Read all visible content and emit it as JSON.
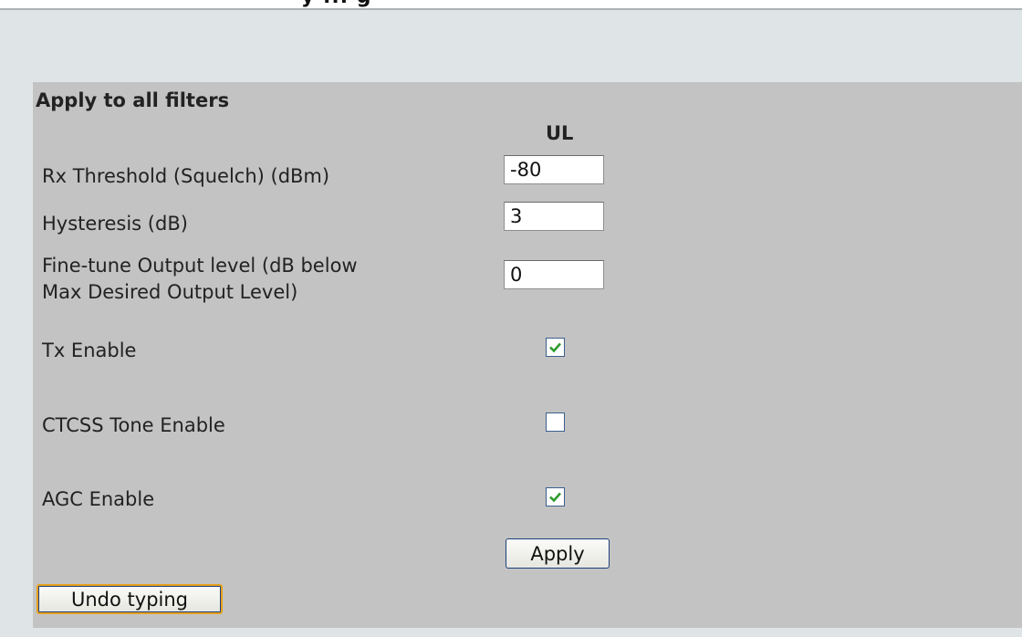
{
  "page": {
    "title_fragment": "y ... g"
  },
  "form": {
    "heading": "Apply to all filters",
    "column_header": "UL",
    "fields": {
      "rx_threshold": {
        "label": "Rx Threshold (Squelch) (dBm)",
        "value": "-80"
      },
      "hysteresis": {
        "label": "Hysteresis (dB)",
        "value": "3"
      },
      "fine_tune_line1": "Fine-tune Output level (dB below",
      "fine_tune_line2": "Max Desired Output Level)",
      "fine_tune_value": "0"
    },
    "checkboxes": {
      "tx_enable": {
        "label": "Tx Enable",
        "checked": true
      },
      "ctcss_enable": {
        "label": "CTCSS Tone Enable",
        "checked": false
      },
      "agc_enable": {
        "label": "AGC Enable",
        "checked": true
      }
    },
    "apply_label": "Apply",
    "undo_label": "Undo typing"
  },
  "colors": {
    "panel_bg": "#c3c3c3",
    "page_bg": "#dfe5e6",
    "check_color": "#2e9b2e",
    "focus_border": "#e8a11c"
  }
}
